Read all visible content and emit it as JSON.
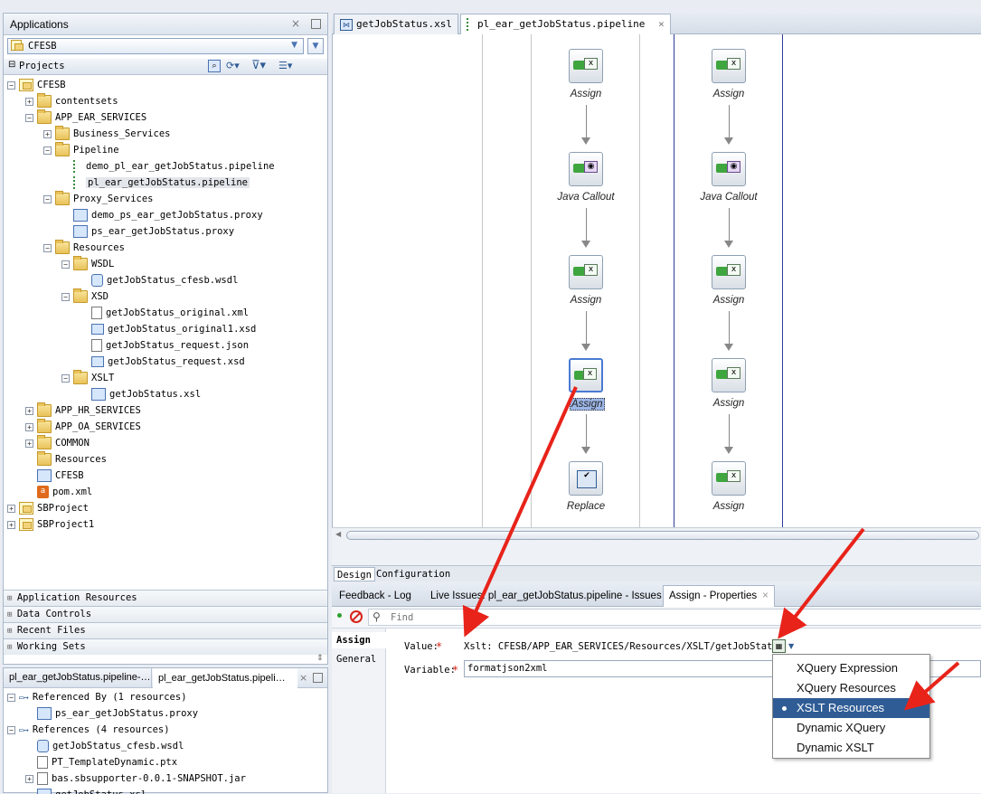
{
  "apps_panel": {
    "title": "Applications",
    "selected_app": "CFESB",
    "projects_label": "Projects"
  },
  "tree": [
    {
      "label": "CFESB",
      "level": 0,
      "toggle": "−",
      "icon": "proj"
    },
    {
      "label": "contentsets",
      "level": 1,
      "toggle": "+",
      "icon": "folder"
    },
    {
      "label": "APP_EAR_SERVICES",
      "level": 1,
      "toggle": "−",
      "icon": "folder"
    },
    {
      "label": "Business_Services",
      "level": 2,
      "toggle": "+",
      "icon": "folder"
    },
    {
      "label": "Pipeline",
      "level": 2,
      "toggle": "−",
      "icon": "folder"
    },
    {
      "label": "demo_pl_ear_getJobStatus.pipeline",
      "level": 3,
      "toggle": "",
      "icon": "pipe"
    },
    {
      "label": "pl_ear_getJobStatus.pipeline",
      "level": 3,
      "toggle": "",
      "icon": "pipe",
      "selected": true
    },
    {
      "label": "Proxy_Services",
      "level": 2,
      "toggle": "−",
      "icon": "folder"
    },
    {
      "label": "demo_ps_ear_getJobStatus.proxy",
      "level": 3,
      "toggle": "",
      "icon": "proxy"
    },
    {
      "label": "ps_ear_getJobStatus.proxy",
      "level": 3,
      "toggle": "",
      "icon": "proxy"
    },
    {
      "label": "Resources",
      "level": 2,
      "toggle": "−",
      "icon": "folder"
    },
    {
      "label": "WSDL",
      "level": 3,
      "toggle": "−",
      "icon": "folder"
    },
    {
      "label": "getJobStatus_cfesb.wsdl",
      "level": 4,
      "toggle": "",
      "icon": "wsdl"
    },
    {
      "label": "XSD",
      "level": 3,
      "toggle": "−",
      "icon": "folder"
    },
    {
      "label": "getJobStatus_original.xml",
      "level": 4,
      "toggle": "",
      "icon": "doc"
    },
    {
      "label": "getJobStatus_original1.xsd",
      "level": 4,
      "toggle": "",
      "icon": "xsd"
    },
    {
      "label": "getJobStatus_request.json",
      "level": 4,
      "toggle": "",
      "icon": "doc"
    },
    {
      "label": "getJobStatus_request.xsd",
      "level": 4,
      "toggle": "",
      "icon": "xsd"
    },
    {
      "label": "XSLT",
      "level": 3,
      "toggle": "−",
      "icon": "folder"
    },
    {
      "label": "getJobStatus.xsl",
      "level": 4,
      "toggle": "",
      "icon": "xsl"
    },
    {
      "label": "APP_HR_SERVICES",
      "level": 1,
      "toggle": "+",
      "icon": "folder"
    },
    {
      "label": "APP_OA_SERVICES",
      "level": 1,
      "toggle": "+",
      "icon": "folder"
    },
    {
      "label": "COMMON",
      "level": 1,
      "toggle": "+",
      "icon": "folder"
    },
    {
      "label": "Resources",
      "level": 1,
      "toggle": "",
      "icon": "folder"
    },
    {
      "label": "CFESB",
      "level": 1,
      "toggle": "",
      "icon": "cfesb"
    },
    {
      "label": "pom.xml",
      "level": 1,
      "toggle": "",
      "icon": "pom"
    },
    {
      "label": "SBProject",
      "level": 0,
      "toggle": "+",
      "icon": "proj"
    },
    {
      "label": "SBProject1",
      "level": 0,
      "toggle": "+",
      "icon": "proj"
    }
  ],
  "accordion": [
    "Application Resources",
    "Data Controls",
    "Recent Files",
    "Working Sets"
  ],
  "bottom_left": {
    "tabs": [
      "pl_ear_getJobStatus.pipeline-…",
      "pl_ear_getJobStatus.pipeli…"
    ],
    "rows": [
      {
        "label": "Referenced By (1 resources)",
        "level": 0,
        "toggle": "−"
      },
      {
        "label": "ps_ear_getJobStatus.proxy",
        "level": 1,
        "toggle": ""
      },
      {
        "label": "References (4 resources)",
        "level": 0,
        "toggle": "−"
      },
      {
        "label": "getJobStatus_cfesb.wsdl",
        "level": 1,
        "toggle": ""
      },
      {
        "label": "PT_TemplateDynamic.ptx",
        "level": 1,
        "toggle": ""
      },
      {
        "label": "bas.sbsupporter-0.0.1-SNAPSHOT.jar",
        "level": 1,
        "toggle": "+"
      },
      {
        "label": "getJobStatus.xsl",
        "level": 1,
        "toggle": ""
      }
    ]
  },
  "editor_tabs": [
    "getJobStatus.xsl",
    "pl_ear_getJobStatus.pipeline"
  ],
  "flow": {
    "left": [
      "Assign",
      "Java Callout",
      "Assign",
      "Assign",
      "Replace"
    ],
    "right": [
      "Assign",
      "Java Callout",
      "Assign",
      "Assign",
      "Assign"
    ]
  },
  "design_tabs": [
    "Design",
    "Configuration"
  ],
  "log_tabs": [
    "Feedback - Log",
    "Live Issues: pl_ear_getJobStatus.pipeline - Issues",
    "Assign - Properties"
  ],
  "find_placeholder": "Find",
  "props": {
    "side_tabs": [
      "Assign",
      "General"
    ],
    "value_label": "Value:",
    "value_text": "Xslt: CFESB/APP_EAR_SERVICES/Resources/XSLT/getJobStatus",
    "variable_label": "Variable:",
    "variable_value": "formatjson2xml",
    "required_mark": "*"
  },
  "dropdown": {
    "items": [
      "XQuery Expression",
      "XQuery Resources",
      "XSLT Resources",
      "Dynamic XQuery",
      "Dynamic XSLT"
    ],
    "selected_index": 2
  },
  "colors": {
    "accent": "#2f5c95",
    "arrow": "#e8231a",
    "selection": "#9db7e8"
  }
}
